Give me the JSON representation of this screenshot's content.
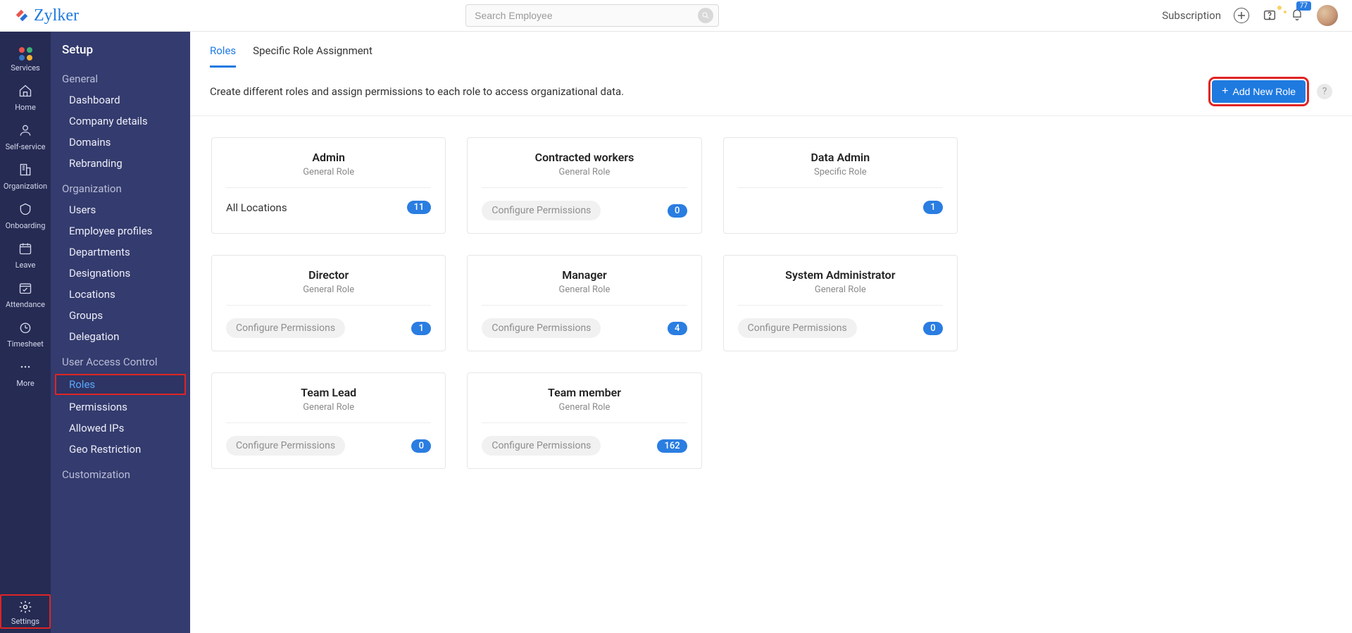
{
  "brand": {
    "name": "Zylker"
  },
  "search": {
    "placeholder": "Search Employee"
  },
  "topRight": {
    "subscription": "Subscription",
    "notificationCount": "77"
  },
  "rail": {
    "items": [
      {
        "key": "services",
        "label": "Services"
      },
      {
        "key": "home",
        "label": "Home"
      },
      {
        "key": "selfservice",
        "label": "Self-service"
      },
      {
        "key": "organization",
        "label": "Organization"
      },
      {
        "key": "onboarding",
        "label": "Onboarding"
      },
      {
        "key": "leave",
        "label": "Leave"
      },
      {
        "key": "attendance",
        "label": "Attendance"
      },
      {
        "key": "timesheet",
        "label": "Timesheet"
      },
      {
        "key": "more",
        "label": "More"
      }
    ],
    "settings": "Settings"
  },
  "sidepanel": {
    "heading": "Setup",
    "groups": [
      {
        "title": "General",
        "items": [
          "Dashboard",
          "Company details",
          "Domains",
          "Rebranding"
        ]
      },
      {
        "title": "Organization",
        "items": [
          "Users",
          "Employee profiles",
          "Departments",
          "Designations",
          "Locations",
          "Groups",
          "Delegation"
        ]
      },
      {
        "title": "User Access Control",
        "items": [
          "Roles",
          "Permissions",
          "Allowed IPs",
          "Geo Restriction"
        ],
        "active": "Roles"
      },
      {
        "title": "Customization",
        "items": []
      }
    ]
  },
  "tabs": {
    "items": [
      "Roles",
      "Specific Role Assignment"
    ],
    "active": "Roles"
  },
  "descRow": {
    "text": "Create different roles and assign permissions to each role to access organizational data.",
    "addBtn": "Add New Role"
  },
  "roles": [
    {
      "name": "Admin",
      "type": "General Role",
      "action": "All Locations",
      "actionStyle": "plain",
      "count": "11"
    },
    {
      "name": "Contracted workers",
      "type": "General Role",
      "action": "Configure Permissions",
      "actionStyle": "chip",
      "count": "0"
    },
    {
      "name": "Data Admin",
      "type": "Specific Role",
      "action": "",
      "actionStyle": "none",
      "count": "1"
    },
    {
      "name": "Director",
      "type": "General Role",
      "action": "Configure Permissions",
      "actionStyle": "chip",
      "count": "1"
    },
    {
      "name": "Manager",
      "type": "General Role",
      "action": "Configure Permissions",
      "actionStyle": "chip",
      "count": "4"
    },
    {
      "name": "System Administrator",
      "type": "General Role",
      "action": "Configure Permissions",
      "actionStyle": "chip",
      "count": "0"
    },
    {
      "name": "Team Lead",
      "type": "General Role",
      "action": "Configure Permissions",
      "actionStyle": "chip",
      "count": "0"
    },
    {
      "name": "Team member",
      "type": "General Role",
      "action": "Configure Permissions",
      "actionStyle": "chip",
      "count": "162"
    }
  ]
}
